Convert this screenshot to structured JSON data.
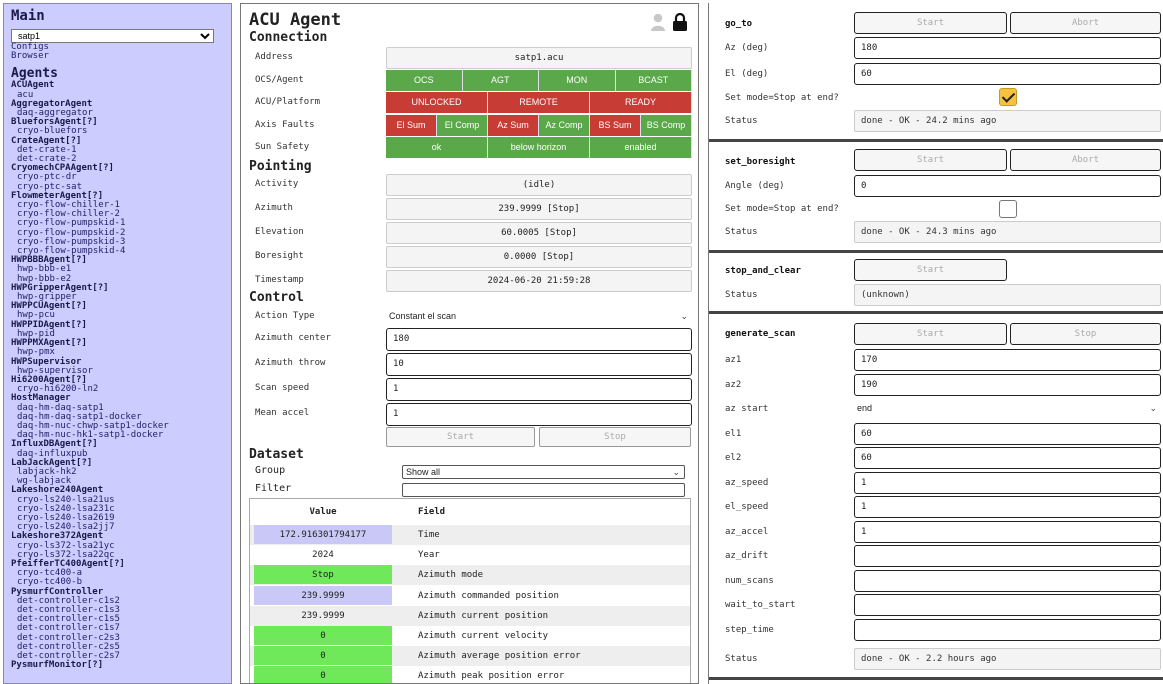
{
  "sidebar": {
    "main_heading": "Main",
    "instance_selected": "satp1",
    "links": [
      "Configs",
      "Browser"
    ],
    "agents_heading": "Agents",
    "agents": [
      {
        "class": "ACUAgent",
        "instances": [
          "acu"
        ]
      },
      {
        "class": "AggregatorAgent",
        "instances": [
          "daq-aggregator"
        ]
      },
      {
        "class": "BlueforsAgent[?]",
        "instances": [
          "cryo-bluefors"
        ]
      },
      {
        "class": "CrateAgent[?]",
        "instances": [
          "det-crate-1",
          "det-crate-2"
        ]
      },
      {
        "class": "CryomechCPAAgent[?]",
        "instances": [
          "cryo-ptc-dr",
          "cryo-ptc-sat"
        ]
      },
      {
        "class": "FlowmeterAgent[?]",
        "instances": [
          "cryo-flow-chiller-1",
          "cryo-flow-chiller-2",
          "cryo-flow-pumpskid-1",
          "cryo-flow-pumpskid-2",
          "cryo-flow-pumpskid-3",
          "cryo-flow-pumpskid-4"
        ]
      },
      {
        "class": "HWPBBBAgent[?]",
        "instances": [
          "hwp-bbb-e1",
          "hwp-bbb-e2"
        ]
      },
      {
        "class": "HWPGripperAgent[?]",
        "instances": [
          "hwp-gripper"
        ]
      },
      {
        "class": "HWPPCUAgent[?]",
        "instances": [
          "hwp-pcu"
        ]
      },
      {
        "class": "HWPPIDAgent[?]",
        "instances": [
          "hwp-pid"
        ]
      },
      {
        "class": "HWPPMXAgent[?]",
        "instances": [
          "hwp-pmx"
        ]
      },
      {
        "class": "HWPSupervisor",
        "instances": [
          "hwp-supervisor"
        ]
      },
      {
        "class": "Hi6200Agent[?]",
        "instances": [
          "cryo-hi6200-ln2"
        ]
      },
      {
        "class": "HostManager",
        "instances": [
          "daq-hm-daq-satp1",
          "daq-hm-daq-satp1-docker",
          "daq-hm-nuc-chwp-satp1-docker",
          "daq-hm-nuc-hk1-satp1-docker"
        ]
      },
      {
        "class": "InfluxDBAgent[?]",
        "instances": [
          "daq-influxpub"
        ]
      },
      {
        "class": "LabJackAgent[?]",
        "instances": [
          "labjack-hk2",
          "wg-labjack"
        ]
      },
      {
        "class": "Lakeshore240Agent",
        "instances": [
          "cryo-ls240-lsa21us",
          "cryo-ls240-lsa231c",
          "cryo-ls240-lsa2619",
          "cryo-ls240-lsa2jj7"
        ]
      },
      {
        "class": "Lakeshore372Agent",
        "instances": [
          "cryo-ls372-lsa21yc",
          "cryo-ls372-lsa22qc"
        ]
      },
      {
        "class": "PfeifferTC400Agent[?]",
        "instances": [
          "cryo-tc400-a",
          "cryo-tc400-b"
        ]
      },
      {
        "class": "PysmurfController",
        "instances": [
          "det-controller-c1s2",
          "det-controller-c1s3",
          "det-controller-c1s5",
          "det-controller-c1s7",
          "det-controller-c2s3",
          "det-controller-c2s5",
          "det-controller-c2s7"
        ]
      },
      {
        "class": "PysmurfMonitor[?]",
        "instances": []
      }
    ]
  },
  "mid": {
    "title": "ACU Agent",
    "connection": {
      "heading": "Connection",
      "address_label": "Address",
      "address_value": "satp1.acu",
      "ocs_label": "OCS/Agent",
      "ocs_cells": [
        "OCS",
        "AGT",
        "MON",
        "BCAST"
      ],
      "platform_label": "ACU/Platform",
      "platform_cells": [
        "UNLOCKED",
        "REMOTE",
        "READY"
      ],
      "faults_label": "Axis Faults",
      "faults_cells": [
        "El Sum",
        "El Comp",
        "Az Sum",
        "Az Comp",
        "BS Sum",
        "BS Comp"
      ],
      "sun_label": "Sun Safety",
      "sun_cells": [
        "ok",
        "below horizon",
        "enabled"
      ]
    },
    "pointing": {
      "heading": "Pointing",
      "rows": [
        {
          "label": "Activity",
          "value": "(idle)"
        },
        {
          "label": "Azimuth",
          "value": "239.9999 [Stop]"
        },
        {
          "label": "Elevation",
          "value": "60.0005 [Stop]"
        },
        {
          "label": "Boresight",
          "value": "0.0000 [Stop]"
        },
        {
          "label": "Timestamp",
          "value": "2024-06-20 21:59:28"
        }
      ]
    },
    "control": {
      "heading": "Control",
      "action_label": "Action Type",
      "action_value": "Constant el scan",
      "az_center_label": "Azimuth center",
      "az_center_value": "180",
      "az_throw_label": "Azimuth throw",
      "az_throw_value": "10",
      "scan_speed_label": "Scan speed",
      "scan_speed_value": "1",
      "mean_accel_label": "Mean accel",
      "mean_accel_value": "1",
      "start_label": "Start",
      "stop_label": "Stop"
    },
    "dataset": {
      "heading": "Dataset",
      "group_label": "Group",
      "group_value": "Show all",
      "filter_label": "Filter",
      "col_value": "Value",
      "col_field": "Field",
      "rows": [
        {
          "value": "172.916301794177",
          "field": "Time",
          "style": "lav"
        },
        {
          "value": "2024",
          "field": "Year",
          "style": "white"
        },
        {
          "value": "Stop",
          "field": "Azimuth mode",
          "style": "grn"
        },
        {
          "value": "239.9999",
          "field": "Azimuth commanded position",
          "style": "lav"
        },
        {
          "value": "239.9999",
          "field": "Azimuth current position",
          "style": "white"
        },
        {
          "value": "0",
          "field": "Azimuth current velocity",
          "style": "grn"
        },
        {
          "value": "0",
          "field": "Azimuth average position error",
          "style": "grn"
        },
        {
          "value": "0",
          "field": "Azimuth peak position error",
          "style": "grn"
        }
      ]
    }
  },
  "right": {
    "go_to": {
      "name": "go_to",
      "start": "Start",
      "abort": "Abort",
      "az_label": "Az (deg)",
      "az_value": "180",
      "el_label": "El (deg)",
      "el_value": "60",
      "stop_label": "Set mode=Stop at end?",
      "status_label": "Status",
      "status_value": "done - OK - 24.2 mins ago"
    },
    "set_boresight": {
      "name": "set_boresight",
      "start": "Start",
      "abort": "Abort",
      "angle_label": "Angle (deg)",
      "angle_value": "0",
      "stop_label": "Set mode=Stop at end?",
      "status_label": "Status",
      "status_value": "done - OK - 24.3 mins ago"
    },
    "stop_and_clear": {
      "name": "stop_and_clear",
      "start": "Start",
      "status_label": "Status",
      "status_value": "(unknown)"
    },
    "generate_scan": {
      "name": "generate_scan",
      "start": "Start",
      "stop": "Stop",
      "params": [
        {
          "label": "az1",
          "value": "170"
        },
        {
          "label": "az2",
          "value": "190"
        },
        {
          "label": "az start",
          "value": "end",
          "select": true
        },
        {
          "label": "el1",
          "value": "60"
        },
        {
          "label": "el2",
          "value": "60"
        },
        {
          "label": "az_speed",
          "value": "1"
        },
        {
          "label": "el_speed",
          "value": "1"
        },
        {
          "label": "az_accel",
          "value": "1"
        },
        {
          "label": "az_drift",
          "value": ""
        },
        {
          "label": "num_scans",
          "value": ""
        },
        {
          "label": "wait_to_start",
          "value": ""
        },
        {
          "label": "step_time",
          "value": ""
        }
      ],
      "status_label": "Status",
      "status_value": "done - OK - 2.2 hours ago"
    }
  },
  "colors": {
    "sidebar_bg": "#ccccff",
    "ok_green": "#5aa84a",
    "alert_red": "#c83c36",
    "value_lavender": "#c9c8f6",
    "value_green": "#6fe85a",
    "checkbox_on": "#f5c242"
  }
}
